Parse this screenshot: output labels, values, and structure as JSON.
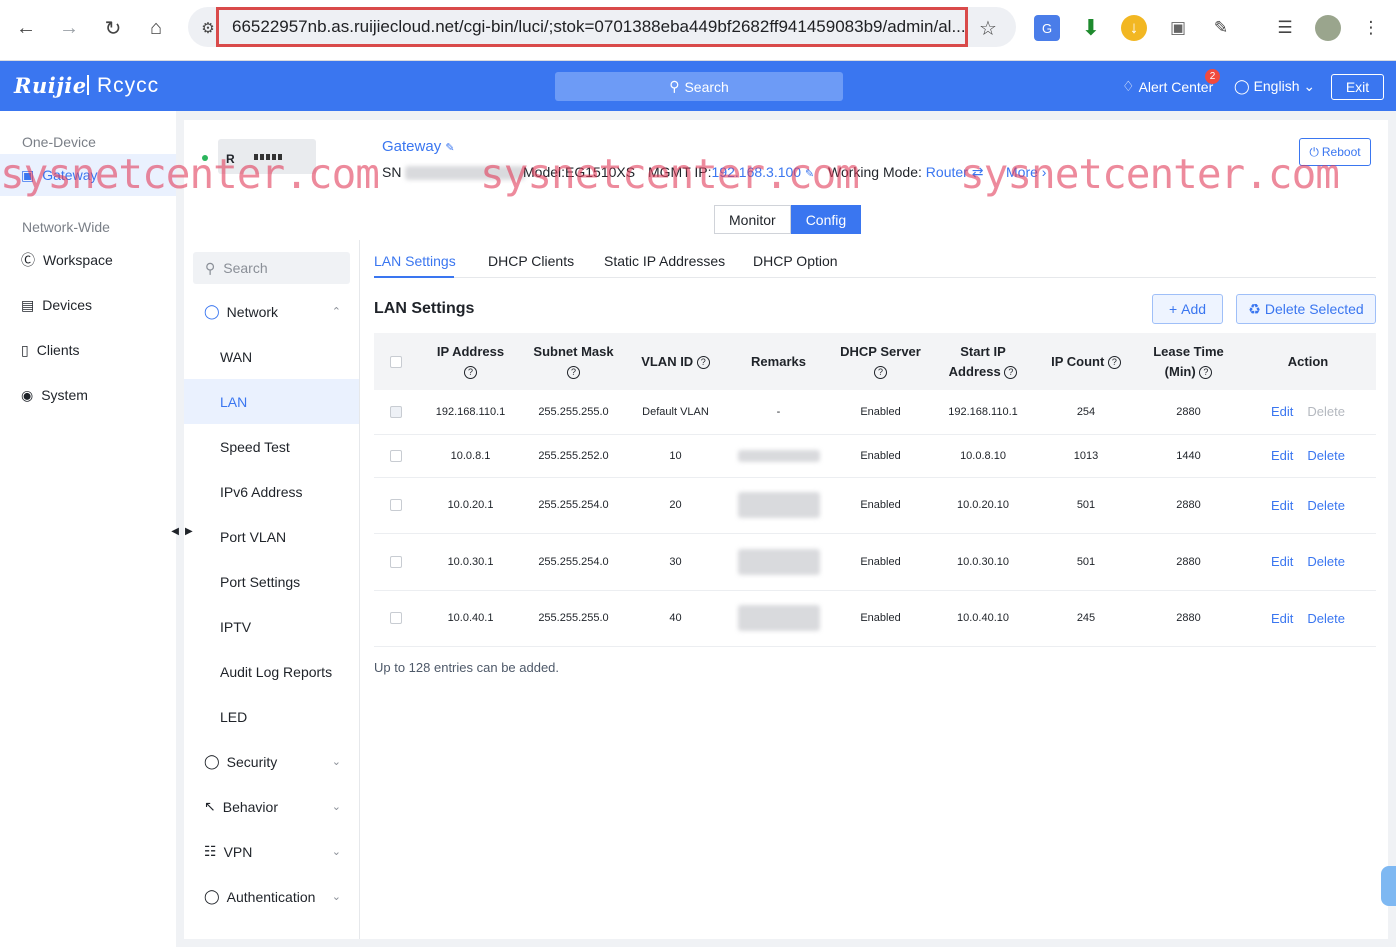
{
  "browser": {
    "url": "66522957nb.as.ruijiecloud.net/cgi-bin/luci/;stok=0701388eba449bf2682ff941459083b9/admin/al..."
  },
  "topbar": {
    "logo": "Ruijie",
    "logo2": "Rcycc",
    "search": "Search",
    "alert": "Alert Center",
    "alert_count": "2",
    "language": "English",
    "exit": "Exit"
  },
  "left_nav": {
    "one_device": "One-Device",
    "gateway": "Gateway",
    "network_wide": "Network-Wide",
    "items": [
      "Workspace",
      "Devices",
      "Clients",
      "System"
    ]
  },
  "device": {
    "name": "Gateway",
    "device_label": "R",
    "sn_label": "SN",
    "model": "Model:EG1510XS",
    "mgmt_label": "MGMT IP:",
    "mgmt_ip": "192.168.3.100",
    "mode_label": "Working Mode:",
    "mode": "Router",
    "more": "More",
    "reboot": "Reboot"
  },
  "watermark": "sysnetcenter.com",
  "mode_toggle": {
    "monitor": "Monitor",
    "config": "Config"
  },
  "sub_nav": {
    "search": "Search",
    "network": "Network",
    "network_items": [
      "WAN",
      "LAN",
      "Speed Test",
      "IPv6 Address",
      "Port VLAN",
      "Port Settings",
      "IPTV",
      "Audit Log Reports",
      "LED"
    ],
    "groups": [
      "Security",
      "Behavior",
      "VPN",
      "Authentication"
    ]
  },
  "tabs": [
    "LAN Settings",
    "DHCP Clients",
    "Static IP Addresses",
    "DHCP Option"
  ],
  "section": {
    "title": "LAN Settings",
    "add": "Add",
    "delete_selected": "Delete Selected"
  },
  "table": {
    "columns": [
      {
        "l1": "IP Address",
        "l2": "",
        "q": true
      },
      {
        "l1": "Subnet Mask",
        "l2": "",
        "q": true
      },
      {
        "l1": "VLAN ID",
        "l2": "",
        "q": true,
        "inline": true
      },
      {
        "l1": "Remarks",
        "l2": "",
        "q": false
      },
      {
        "l1": "DHCP Server",
        "l2": "",
        "q": true
      },
      {
        "l1": "Start IP",
        "l2": "Address",
        "q": true
      },
      {
        "l1": "IP Count",
        "l2": "",
        "q": true,
        "inline": true
      },
      {
        "l1": "Lease Time",
        "l2": "(Min)",
        "q": true
      },
      {
        "l1": "Action",
        "l2": "",
        "q": false
      }
    ],
    "rows": [
      {
        "ip": "192.168.110.1",
        "mask": "255.255.255.0",
        "vlan": "Default VLAN",
        "remarks": "-",
        "dhcp": "Enabled",
        "start": "192.168.110.1",
        "count": "254",
        "lease": "2880",
        "delete_enabled": false
      },
      {
        "ip": "10.0.8.1",
        "mask": "255.255.252.0",
        "vlan": "10",
        "remarks": "",
        "dhcp": "Enabled",
        "start": "10.0.8.10",
        "count": "1013",
        "lease": "1440",
        "delete_enabled": true
      },
      {
        "ip": "10.0.20.1",
        "mask": "255.255.254.0",
        "vlan": "20",
        "remarks": "",
        "dhcp": "Enabled",
        "start": "10.0.20.10",
        "count": "501",
        "lease": "2880",
        "delete_enabled": true
      },
      {
        "ip": "10.0.30.1",
        "mask": "255.255.254.0",
        "vlan": "30",
        "remarks": "",
        "dhcp": "Enabled",
        "start": "10.0.30.10",
        "count": "501",
        "lease": "2880",
        "delete_enabled": true
      },
      {
        "ip": "10.0.40.1",
        "mask": "255.255.255.0",
        "vlan": "40",
        "remarks": "",
        "dhcp": "Enabled",
        "start": "10.0.40.10",
        "count": "245",
        "lease": "2880",
        "delete_enabled": true
      }
    ],
    "edit": "Edit",
    "delete": "Delete"
  },
  "note": "Up to 128 entries can be added.",
  "colors": {
    "primary": "#3a76f0",
    "active_bg": "#eaf1fe",
    "watermark": "#e13c5a"
  }
}
